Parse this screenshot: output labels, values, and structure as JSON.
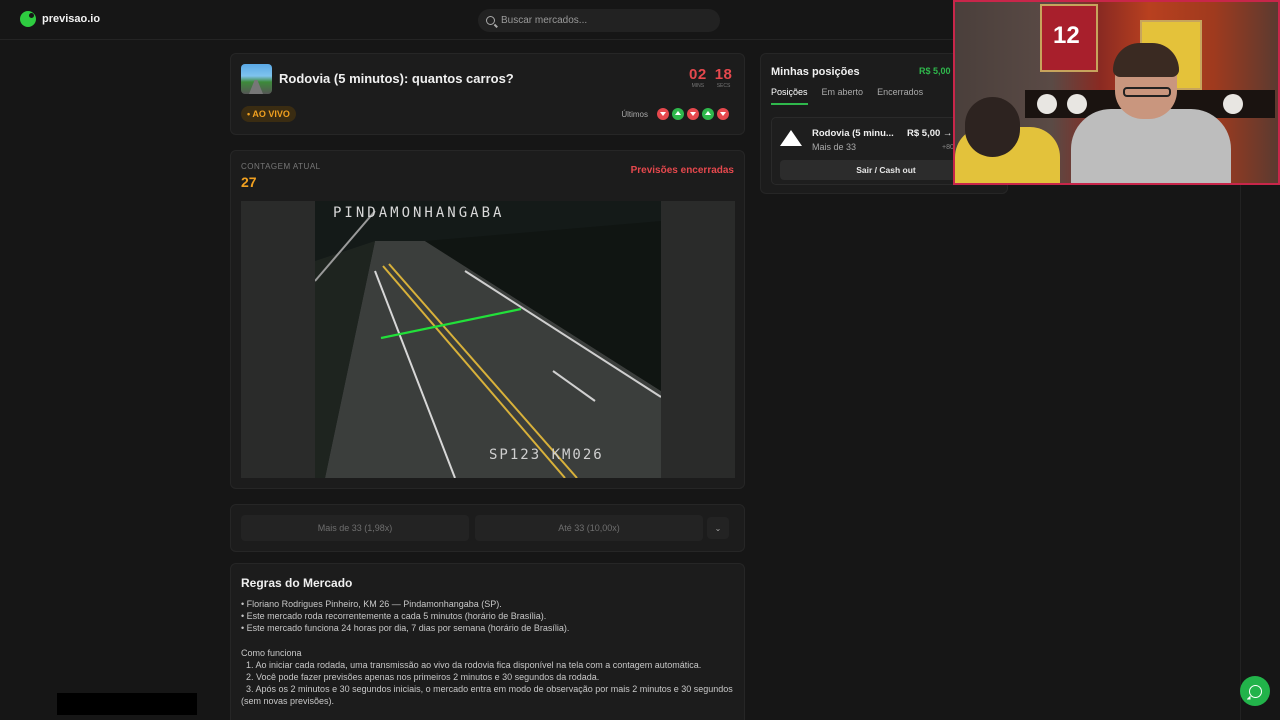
{
  "header": {
    "logo_text": "previsao.io",
    "search_placeholder": "Buscar mercados..."
  },
  "market": {
    "title": "Rodovia (5 minutos): quantos carros?",
    "timer": {
      "minutes": "02",
      "minutes_label": "mins",
      "seconds": "18",
      "seconds_label": "secs"
    },
    "live_badge": "• AO VIVO",
    "recent_label": "Últimos",
    "recent_results": [
      "down",
      "up",
      "down",
      "up",
      "down"
    ],
    "colors": {
      "accent_green": "#2fb84c",
      "accent_red": "#e5484d",
      "accent_orange": "#f0a020"
    }
  },
  "camera": {
    "count_label": "CONTAGEM ATUAL",
    "count_value": "27",
    "status": "Previsões encerradas",
    "overlay_top": "PINDAMONHANGABA",
    "overlay_bottom": "SP123 KM026"
  },
  "bets": {
    "option_1": "Mais de 33 (1,98x)",
    "option_2": "Até 33 (10,00x)",
    "expand_icon": "chevron-down-icon"
  },
  "rules": {
    "title": "Regras do Mercado",
    "lines": [
      "• Floriano Rodrigues Pinheiro, KM 26 — Pindamonhangaba (SP).",
      "• Este mercado roda recorrentemente a cada 5 minutos (horário de Brasília).",
      "• Este mercado funciona 24 horas por dia, 7 dias por semana (horário de Brasília)."
    ],
    "how_title": "Como funciona",
    "how_lines": [
      "  1. Ao iniciar cada rodada, uma transmissão ao vivo da rodovia fica disponível na tela com a contagem automática.",
      "  2. Você pode fazer previsões apenas nos primeiros 2 minutos e 30 segundos da rodada.",
      "  3. Após os 2 minutos e 30 segundos iniciais, o mercado entra em modo de observação por mais 2 minutos e 30 segundos (sem novas previsões)."
    ]
  },
  "positions": {
    "title": "Minhas posições",
    "total": "R$ 5,00",
    "tabs": [
      "Posições",
      "Em aberto",
      "Encerrados"
    ],
    "active_tab": 0,
    "item": {
      "name": "Rodovia (5 minu...",
      "outcome": "Mais de 33",
      "value": "R$ 5,00 →",
      "extra": "+80",
      "cashout_label": "Sair / Cash out"
    }
  },
  "webcam": {
    "jersey_number": "12"
  }
}
